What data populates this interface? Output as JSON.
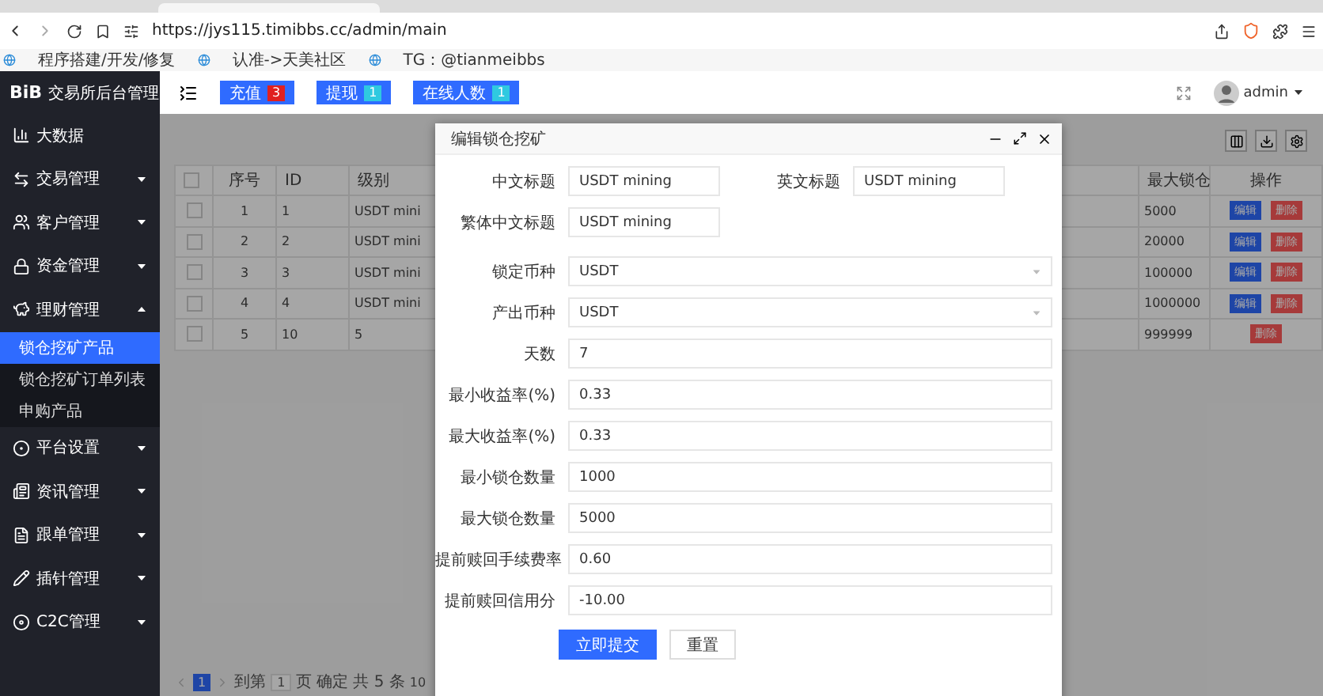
{
  "browser": {
    "url": "https://jys115.timibbs.cc/admin/main",
    "bookmarks": [
      "程序搭建/开发/修复",
      "认准->天美社区",
      "TG：@tianmeibbs"
    ]
  },
  "sidebar": {
    "logo": "BiB",
    "title": "交易所后台管理",
    "items": [
      {
        "label": "大数据"
      },
      {
        "label": "交易管理",
        "expanded": false
      },
      {
        "label": "客户管理",
        "expanded": false
      },
      {
        "label": "资金管理",
        "expanded": false
      },
      {
        "label": "理财管理",
        "expanded": true,
        "children": [
          {
            "label": "锁仓挖矿产品",
            "selected": true
          },
          {
            "label": "锁仓挖矿订单列表",
            "selected": false
          },
          {
            "label": "申购产品",
            "selected": false
          }
        ]
      },
      {
        "label": "平台设置",
        "expanded": false
      },
      {
        "label": "资讯管理",
        "expanded": false
      },
      {
        "label": "跟单管理",
        "expanded": false
      },
      {
        "label": "插针管理",
        "expanded": false
      },
      {
        "label": "C2C管理",
        "expanded": false
      }
    ]
  },
  "header": {
    "badges": [
      {
        "label": "充值",
        "count": "3",
        "color": "#e02020"
      },
      {
        "label": "提现",
        "count": "1",
        "color": "#2fc9e0"
      },
      {
        "label": "在线人数",
        "count": "1",
        "color": "#2fc9e0"
      }
    ],
    "user": "admin"
  },
  "table": {
    "select_all_checked": false,
    "columns": [
      "序号",
      "ID",
      "级别",
      "最大锁仓",
      "操作"
    ],
    "rows": [
      {
        "checked": false,
        "cells": [
          "1",
          "1",
          "USDT mini",
          "5000"
        ],
        "actions": [
          {
            "label": "编辑",
            "kind": "edit"
          },
          {
            "label": "删除",
            "kind": "delete"
          }
        ]
      },
      {
        "checked": false,
        "cells": [
          "2",
          "2",
          "USDT mini",
          "20000"
        ],
        "actions": [
          {
            "label": "编辑",
            "kind": "edit"
          },
          {
            "label": "删除",
            "kind": "delete"
          }
        ]
      },
      {
        "checked": false,
        "cells": [
          "3",
          "3",
          "USDT mini",
          "100000"
        ],
        "actions": [
          {
            "label": "编辑",
            "kind": "edit"
          },
          {
            "label": "删除",
            "kind": "delete"
          }
        ]
      },
      {
        "checked": false,
        "cells": [
          "4",
          "4",
          "USDT mini",
          "1000000"
        ],
        "actions": [
          {
            "label": "编辑",
            "kind": "edit"
          },
          {
            "label": "删除",
            "kind": "delete"
          }
        ]
      },
      {
        "checked": false,
        "cells": [
          "5",
          "10",
          "5",
          "999999"
        ],
        "actions": [
          {
            "label": "删除",
            "kind": "delete"
          }
        ]
      }
    ]
  },
  "pagination": {
    "pages": [
      {
        "label": "1",
        "selected": true
      }
    ],
    "goto_label": "到第",
    "goto_value": "1",
    "page_unit": "页",
    "confirm": "确定",
    "total": "共 5 条",
    "page_size": "10"
  },
  "modal": {
    "title": "编辑锁仓挖矿",
    "rows": [
      {
        "fields": [
          {
            "label": "中文标题",
            "value": "USDT mining",
            "kind": "short"
          },
          {
            "label": "英文标题",
            "value": "USDT mining",
            "kind": "short"
          }
        ]
      },
      {
        "fields": [
          {
            "label": "繁体中文标题",
            "value": "USDT mining",
            "kind": "short"
          }
        ]
      },
      {
        "fields": [
          {
            "label": "锁定币种",
            "value": "USDT",
            "kind": "select"
          }
        ]
      },
      {
        "fields": [
          {
            "label": "产出币种",
            "value": "USDT",
            "kind": "select"
          }
        ]
      },
      {
        "fields": [
          {
            "label": "天数",
            "value": "7",
            "kind": "input"
          }
        ]
      },
      {
        "fields": [
          {
            "label": "最小收益率(%)",
            "value": "0.33",
            "kind": "input"
          }
        ]
      },
      {
        "fields": [
          {
            "label": "最大收益率(%)",
            "value": "0.33",
            "kind": "input"
          }
        ]
      },
      {
        "fields": [
          {
            "label": "最小锁仓数量",
            "value": "1000",
            "kind": "input"
          }
        ]
      },
      {
        "fields": [
          {
            "label": "最大锁仓数量",
            "value": "5000",
            "kind": "input"
          }
        ]
      },
      {
        "fields": [
          {
            "label": "提前赎回手续费率",
            "value": "0.60",
            "kind": "input"
          }
        ]
      },
      {
        "fields": [
          {
            "label": "提前赎回信用分",
            "value": "-10.00",
            "kind": "input"
          }
        ]
      }
    ],
    "buttons": [
      {
        "label": "立即提交",
        "kind": "primary"
      },
      {
        "label": "重置",
        "kind": "default"
      }
    ]
  }
}
